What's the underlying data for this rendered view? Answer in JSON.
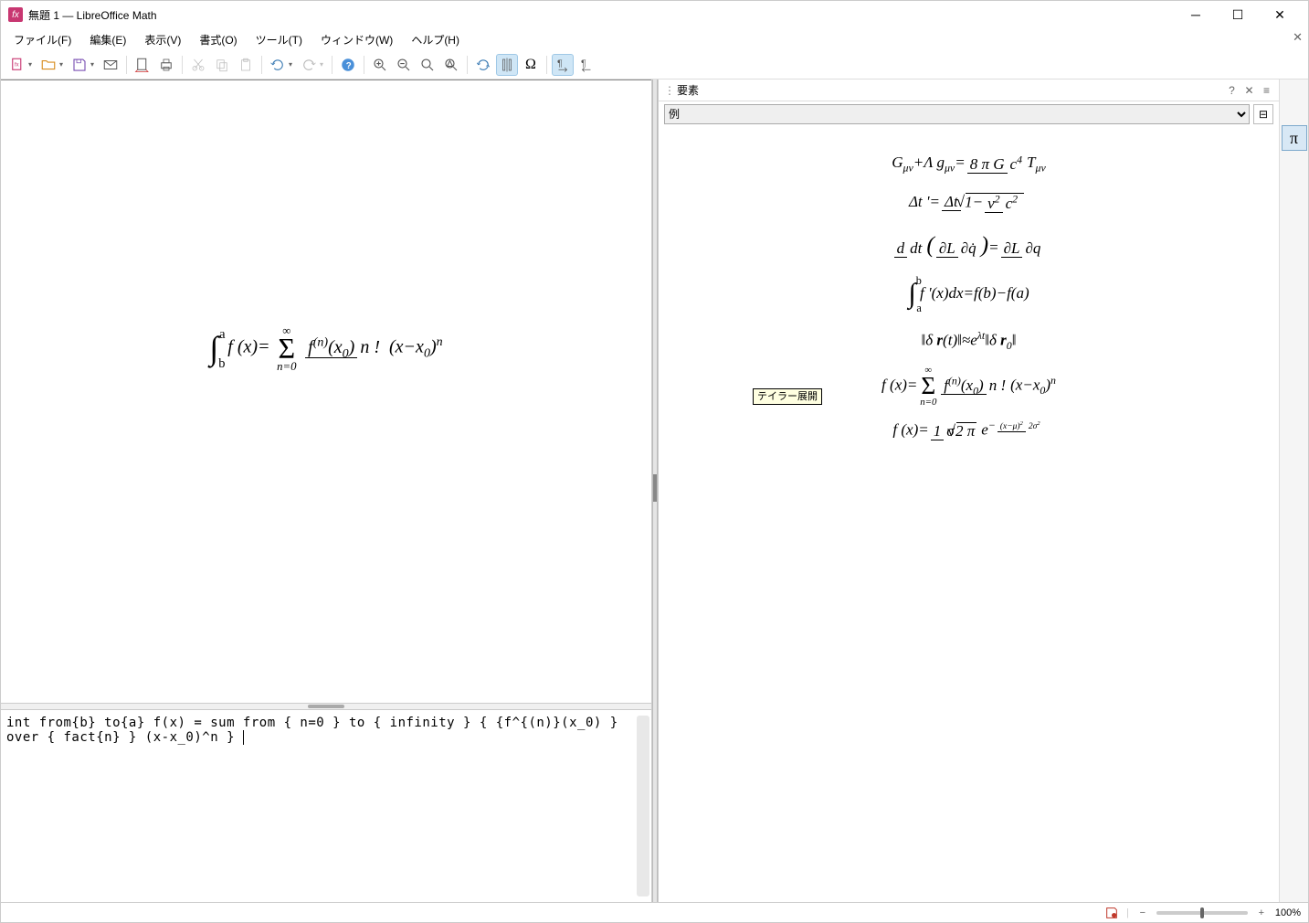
{
  "title": "無題 1 — LibreOffice Math",
  "menu": {
    "file": "ファイル(F)",
    "edit": "編集(E)",
    "view": "表示(V)",
    "format": "書式(O)",
    "tools": "ツール(T)",
    "window": "ウィンドウ(W)",
    "help": "ヘルプ(H)"
  },
  "editor_text": "int from{b} to{a} f(x) = sum from { n=0 } to { infinity } { {f^{(n)}(x_0) } over { fact{n} } (x-x_0)^n }",
  "panel": {
    "title": "要素",
    "category": "例",
    "tooltip": "テイラー展開"
  },
  "status": {
    "zoom": "100%"
  },
  "formula_main": "∫ f(x) = Σ f⁽ⁿ⁾(x₀)/n! (x−x₀)ⁿ",
  "examples": {
    "einstein": "Gμν + Λgμν = 8πG/c⁴ Tμν",
    "time_dilation": "Δt' = Δt / √(1 − v²/c²)",
    "lagrange": "d/dt (∂L/∂q̇) = ∂L/∂q",
    "ftc": "∫ₐᵇ f'(x)dx = f(b) − f(a)",
    "lyapunov": "‖δr(t)‖ ≈ eᵏᵗ‖δr₀‖",
    "taylor": "f(x) = Σ f⁽ⁿ⁾(x₀)/n! (x−x₀)ⁿ",
    "gauss": "f(x) = 1/(σ√2π) e^(−(x−μ)²/2σ²)"
  }
}
